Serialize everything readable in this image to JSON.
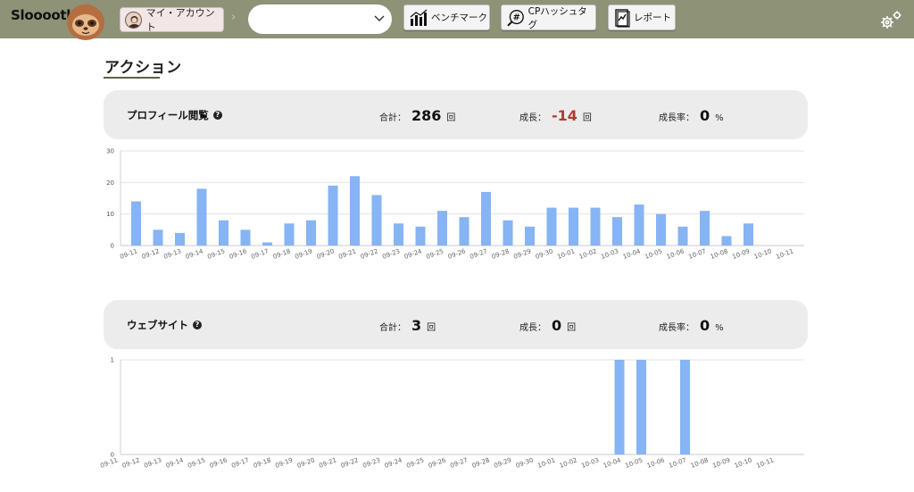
{
  "header": {
    "logo_text": "Slooooth",
    "account_label": "マイ・アカウント",
    "separator": "›",
    "select_value": "",
    "benchmark_label": "ベンチマーク",
    "hashtag_label": "CPハッシュタグ",
    "hashtag_icon_text": "#",
    "report_label": "レポート",
    "colors": {
      "bar_bg": "#8e9277",
      "accent_negative": "#b03a2e",
      "bar_fill": "#86b4f4"
    }
  },
  "page": {
    "title": "アクション"
  },
  "profile_views": {
    "label": "プロフィール閲覧",
    "help": "?",
    "total_label": "合計：",
    "total_value": "286",
    "total_unit": "回",
    "growth_label": "成長：",
    "growth_value": "-14",
    "growth_unit": "回",
    "rate_label": "成長率：",
    "rate_value": "0",
    "rate_unit": "%"
  },
  "website": {
    "label": "ウェブサイト",
    "help": "?",
    "total_label": "合計：",
    "total_value": "3",
    "total_unit": "回",
    "growth_label": "成長：",
    "growth_value": "0",
    "growth_unit": "回",
    "rate_label": "成長率：",
    "rate_value": "0",
    "rate_unit": "%"
  },
  "chart_data": [
    {
      "type": "bar",
      "categories": [
        "09-11",
        "09-12",
        "09-13",
        "09-14",
        "09-15",
        "09-16",
        "09-17",
        "09-18",
        "09-19",
        "09-20",
        "09-21",
        "09-22",
        "09-23",
        "09-24",
        "09-25",
        "09-26",
        "09-27",
        "09-28",
        "09-29",
        "09-30",
        "10-01",
        "10-02",
        "10-03",
        "10-04",
        "10-05",
        "10-06",
        "10-07",
        "10-08",
        "10-09",
        "10-10",
        "10-11"
      ],
      "values": [
        14,
        5,
        4,
        18,
        8,
        5,
        1,
        7,
        8,
        19,
        22,
        16,
        7,
        6,
        11,
        9,
        17,
        8,
        6,
        12,
        12,
        12,
        9,
        13,
        10,
        6,
        11,
        3,
        7,
        0,
        0
      ],
      "yticks": [
        "0",
        "10",
        "20",
        "30"
      ],
      "ylim": [
        0,
        30
      ],
      "grid": true
    },
    {
      "type": "bar",
      "categories": [
        "09-11",
        "09-12",
        "09-13",
        "09-14",
        "09-15",
        "09-16",
        "09-17",
        "09-18",
        "09-19",
        "09-20",
        "09-21",
        "09-22",
        "09-23",
        "09-24",
        "09-25",
        "09-26",
        "09-27",
        "09-28",
        "09-29",
        "09-30",
        "10-01",
        "10-02",
        "10-03",
        "10-04",
        "10-05",
        "10-06",
        "10-07",
        "10-08",
        "10-09",
        "10-10",
        "10-11"
      ],
      "values": [
        0,
        0,
        0,
        0,
        0,
        0,
        0,
        0,
        0,
        0,
        0,
        0,
        0,
        0,
        0,
        0,
        0,
        0,
        0,
        0,
        0,
        0,
        0,
        1,
        1,
        0,
        1,
        0,
        0,
        0,
        0
      ],
      "yticks": [
        "0",
        "1"
      ],
      "ylim": [
        0,
        1
      ],
      "grid": true
    }
  ]
}
